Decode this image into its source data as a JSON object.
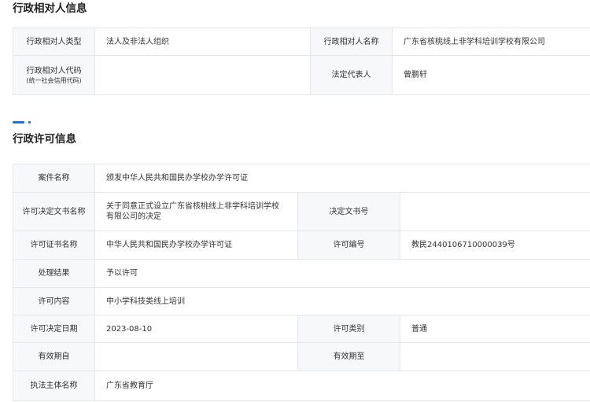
{
  "party_section": {
    "title": "行政相对人信息",
    "rows": [
      {
        "k1": "行政相对人类型",
        "v1": "法人及非法人组织",
        "k2": "行政相对人名称",
        "v2": "广东省核桃线上非学科培训学校有限公司"
      },
      {
        "k1": "行政相对人代码",
        "k1_sub": "(统一社会信用代码)",
        "v1": "",
        "k2": "法定代表人",
        "v2": "曾鹏轩"
      }
    ]
  },
  "license_section": {
    "title": "行政许可信息",
    "case_name_label": "案件名称",
    "case_name_value": "颁发中华人民共和国民办学校办学许可证",
    "decision_doc_name_label": "许可决定文书名称",
    "decision_doc_name_value": "关于同意正式设立广东省核桃线上非学科培训学校有限公司的决定",
    "decision_doc_no_label": "决定文书号",
    "decision_doc_no_value": "",
    "cert_name_label": "许可证书名称",
    "cert_name_value": "中华人民共和国民办学校办学许可证",
    "license_no_label": "许可编号",
    "license_no_value": "教民2440106710000039号",
    "result_label": "处理结果",
    "result_value": "予以许可",
    "content_label": "许可内容",
    "content_value": "中小学科技类线上培训",
    "decision_date_label": "许可决定日期",
    "decision_date_value": "2023-08-10",
    "category_label": "许可类别",
    "category_value": "普通",
    "valid_from_label": "有效期自",
    "valid_from_value": "",
    "valid_to_label": "有效期至",
    "valid_to_value": "",
    "authority_label": "执法主体名称",
    "authority_value": "广东省教育厅"
  }
}
